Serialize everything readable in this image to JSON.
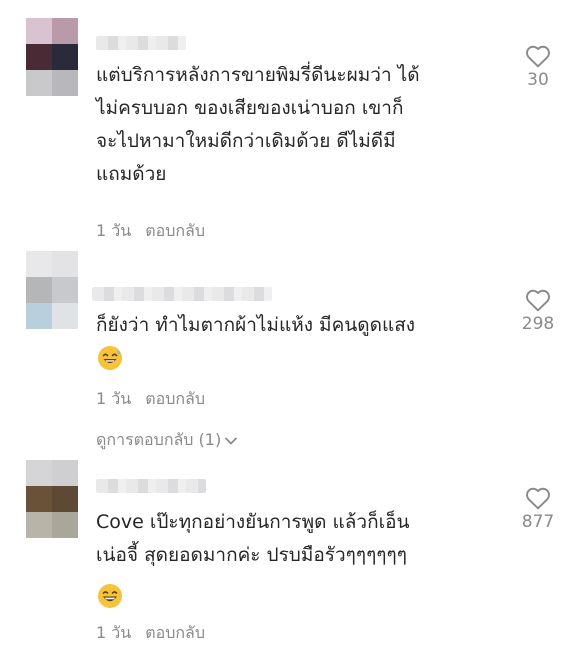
{
  "comments": [
    {
      "text": "แต่บริการหลังการขายพิมรี่ดีนะผมว่า ได้\nไม่ครบบอก ของเสียของเน่าบอก เขาก็\nจะไปหามาใหม่ดีกว่าเดิมด้วย ดีไม่ดีมี\nแถมด้วย",
      "time": "1 วัน",
      "reply_label": "ตอบกลับ",
      "like_count": "30",
      "avatar_colors": [
        "#d9c3d0",
        "#b89aa8",
        "#4a2a34",
        "#2a2a3a",
        "#c9c9cc",
        "#b8b8bc"
      ]
    },
    {
      "text": "ก็ยังว่า ทำไมตากผ้าไม่แห้ง มีคนดูดแสง",
      "time": "1 วัน",
      "reply_label": "ตอบกลับ",
      "like_count": "298",
      "view_replies": "ดูการตอบกลับ (1)",
      "emoji": "sweat-smile-emoji",
      "avatar_colors": [
        "#e8e8ea",
        "#e3e3e6",
        "#b5b6b8",
        "#c7c9cc",
        "#b9d0dc",
        "#dfe3e6"
      ]
    },
    {
      "text": "Cove เป๊ะทุกอย่างยันการพูด แล้วก็เอ็น\nเน่อจี้ สุดยอดมากค่ะ ปรบมือรัวๆๆๆๆๆๆ",
      "time": "1 วัน",
      "reply_label": "ตอบกลับ",
      "like_count": "877",
      "emoji": "grinning-emoji",
      "avatar_colors": [
        "#d5d5d7",
        "#cfcfd1",
        "#6a5238",
        "#5e4a34",
        "#b8b5a8",
        "#a9a79a"
      ]
    }
  ],
  "icons": {
    "like": "heart-outline-icon",
    "expand": "chevron-down-icon"
  }
}
